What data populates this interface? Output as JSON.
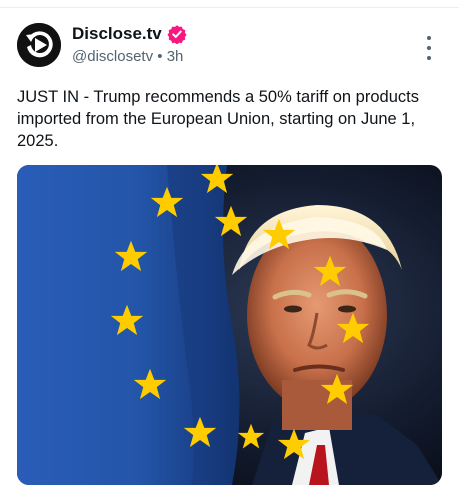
{
  "post": {
    "author_name": "Disclose.tv",
    "handle": "@disclosetv",
    "separator": "•",
    "time": "3h",
    "text": "JUST IN - Trump recommends a 50% tariff on products imported from the European Union, starting on June 1, 2025.",
    "verified": true
  },
  "icons": {
    "avatar": "disclose-play-logo",
    "badge": "verified-badge",
    "menu": "more-vertical-icon"
  },
  "colors": {
    "verified_badge": "#f91880",
    "handle_gray": "#536471",
    "eu_blue": "#1f4fa0",
    "eu_star": "#ffcc00"
  }
}
